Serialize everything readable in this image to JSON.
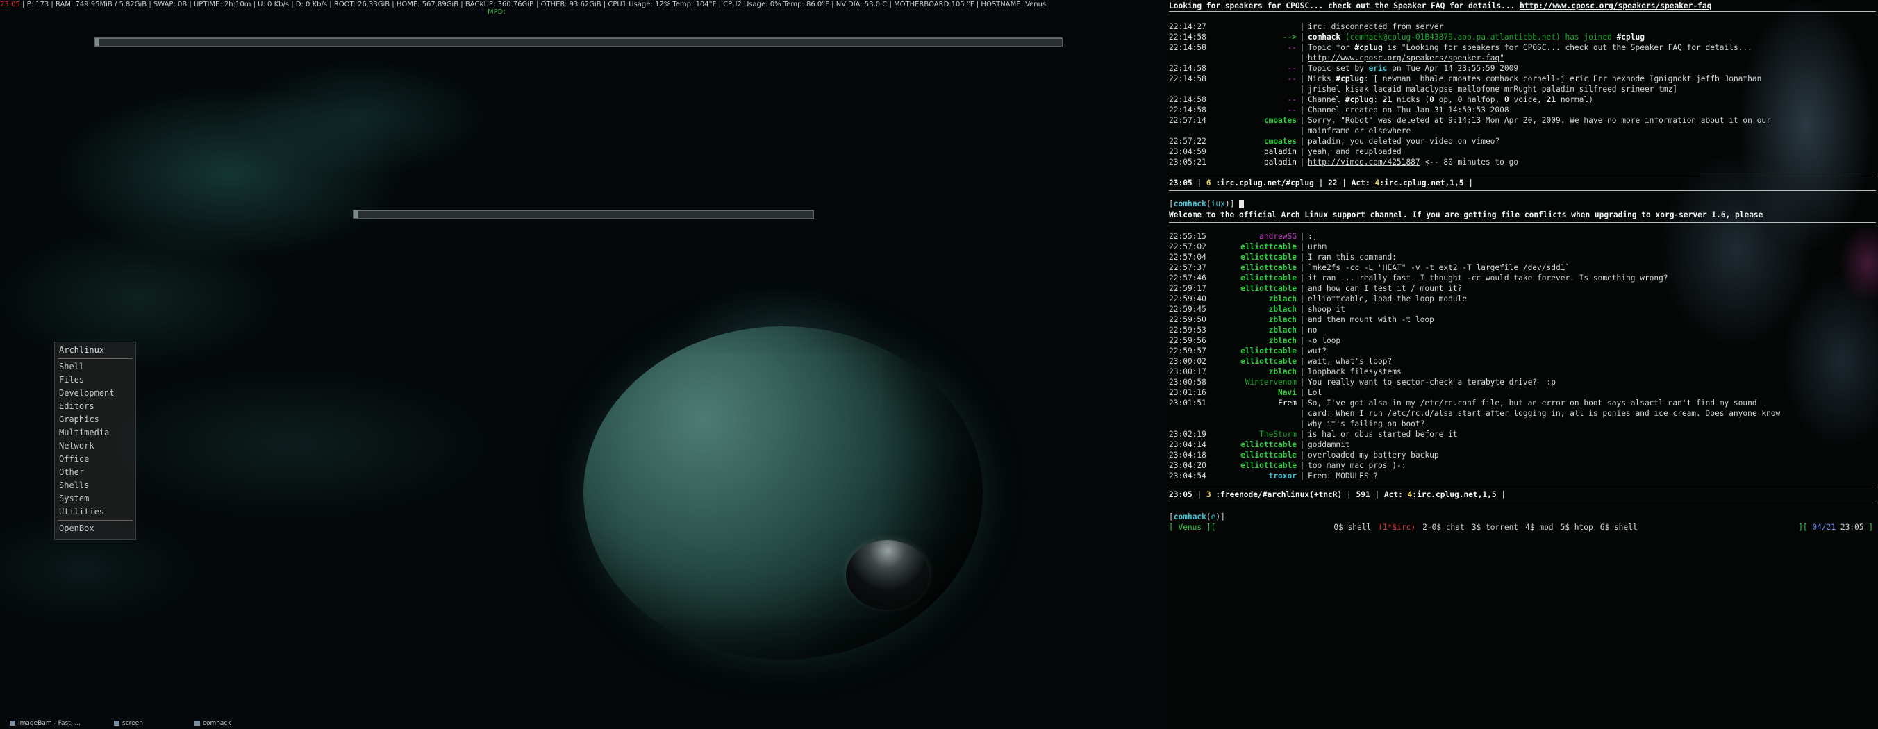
{
  "statusbar": {
    "time": "23:05",
    "items": [
      "P: 173",
      "RAM: 749.95MiB / 5.82GiB",
      "SWAP:  0B",
      "UPTIME: 2h:10m",
      "U: 0 Kb/s",
      "D: 0 Kb/s",
      "ROOT: 26.33GiB",
      "HOME: 567.89GiB",
      "BACKUP: 360.76GiB",
      "OTHER: 93.62GiB",
      "CPU1 Usage: 12% Temp:  104°F",
      "CPU2 Usage: 0% Temp:  86.0°F",
      "NVIDIA: 53.0 C",
      "MOTHERBOARD:105 °F",
      "HOSTNAME: Venus"
    ],
    "mpd": "MPD:"
  },
  "bars": {
    "bar1_fill": 0.004,
    "bar2_fill": 0.01
  },
  "menu": {
    "title": "Archlinux",
    "items": [
      "Shell",
      "Files",
      "Development",
      "Editors",
      "Graphics",
      "Multimedia",
      "Network",
      "Office",
      "Other",
      "Shells",
      "System",
      "Utilities"
    ],
    "footer": "OpenBox"
  },
  "taskbar": {
    "tasks": [
      {
        "label": "ImageBam - Fast, ..."
      },
      {
        "label": "screen"
      },
      {
        "label": "comhack"
      }
    ]
  },
  "irc1": {
    "topic_header": "Looking for speakers for CPOSC... check out the Speaker FAQ for details... ",
    "topic_header_url": "http://www.cposc.org/speakers/speaker-faq",
    "lines": [
      {
        "ts": "22:14:27",
        "nick": "",
        "parts": [
          {
            "t": "irc: disconnected from server",
            "c": ""
          }
        ]
      },
      {
        "ts": "22:14:58",
        "nick": "-->",
        "nc": "green",
        "parts": [
          {
            "t": "comhack",
            "c": "white bold"
          },
          {
            "t": " (comhack@cplug-01B43879.aoo.pa.atlanticbb.net) has joined ",
            "c": "dgreen"
          },
          {
            "t": "#cplug",
            "c": "white bold"
          }
        ]
      },
      {
        "ts": "22:14:58",
        "nick": "--",
        "nc": "magenta",
        "parts": [
          {
            "t": "Topic for ",
            "c": ""
          },
          {
            "t": "#cplug",
            "c": "white bold"
          },
          {
            "t": " is \"Looking for speakers for CPOSC... check out the Speaker FAQ for details...",
            "c": ""
          }
        ]
      },
      {
        "ts": "",
        "nick": "",
        "parts": [
          {
            "t": "http://www.cposc.org/speakers/speaker-faq\"",
            "c": "ul"
          }
        ]
      },
      {
        "ts": "22:14:58",
        "nick": "--",
        "nc": "magenta",
        "parts": [
          {
            "t": "Topic set by ",
            "c": ""
          },
          {
            "t": "eric",
            "c": "cyan bold"
          },
          {
            "t": " on Tue Apr 14 23:55:59 2009",
            "c": ""
          }
        ]
      },
      {
        "ts": "22:14:58",
        "nick": "--",
        "nc": "magenta",
        "parts": [
          {
            "t": "Nicks ",
            "c": ""
          },
          {
            "t": "#cplug",
            "c": "white bold"
          },
          {
            "t": ": [_newman_ bhale cmoates comhack cornell-j eric Err hexnode Ignignokt jeffb Jonathan",
            "c": ""
          }
        ]
      },
      {
        "ts": "",
        "nick": "",
        "parts": [
          {
            "t": "jrishel kisak lacaid malaclypse mellofone mrRught paladin silfreed srineer tmz]",
            "c": ""
          }
        ]
      },
      {
        "ts": "22:14:58",
        "nick": "--",
        "nc": "magenta",
        "parts": [
          {
            "t": "Channel ",
            "c": ""
          },
          {
            "t": "#cplug",
            "c": "white bold"
          },
          {
            "t": ": ",
            "c": ""
          },
          {
            "t": "21",
            "c": "white bold"
          },
          {
            "t": " nicks (",
            "c": ""
          },
          {
            "t": "0",
            "c": "white bold"
          },
          {
            "t": " op, ",
            "c": ""
          },
          {
            "t": "0",
            "c": "white bold"
          },
          {
            "t": " halfop, ",
            "c": ""
          },
          {
            "t": "0",
            "c": "white bold"
          },
          {
            "t": " voice, ",
            "c": ""
          },
          {
            "t": "21",
            "c": "white bold"
          },
          {
            "t": " normal)",
            "c": ""
          }
        ]
      },
      {
        "ts": "22:14:58",
        "nick": "--",
        "nc": "magenta",
        "parts": [
          {
            "t": "Channel created on Thu Jan 31 14:50:53 2008",
            "c": ""
          }
        ]
      },
      {
        "ts": "22:57:14",
        "nick": "cmoates",
        "nc": "green bold",
        "parts": [
          {
            "t": "Sorry, \"Robot\" was deleted at 9:14:13 Mon Apr 20, 2009. We have no more information about it on our",
            "c": ""
          }
        ]
      },
      {
        "ts": "",
        "nick": "",
        "parts": [
          {
            "t": "mainframe or elsewhere.",
            "c": ""
          }
        ]
      },
      {
        "ts": "22:57:22",
        "nick": "cmoates",
        "nc": "green bold",
        "parts": [
          {
            "t": "paladin, you deleted your video on vimeo?",
            "c": ""
          }
        ]
      },
      {
        "ts": "23:04:59",
        "nick": "paladin",
        "nc": "white",
        "parts": [
          {
            "t": "yeah, and reuploaded",
            "c": ""
          }
        ]
      },
      {
        "ts": "23:05:21",
        "nick": "paladin",
        "nc": "white",
        "parts": [
          {
            "t": "http://vimeo.com/4251887",
            "c": "ul"
          },
          {
            "t": " <-- 80 minutes to go",
            "c": ""
          }
        ]
      }
    ],
    "status": {
      "time": "23:05",
      "win": "6",
      "chan": ":irc.cplug.net/#cplug",
      "count": "22",
      "act": "Act: ",
      "actnum": "4",
      "actrest": ":irc.cplug.net,1,5"
    }
  },
  "irc2": {
    "input_nick": "comhack",
    "input_mode": "iux",
    "topic": "Welcome to the official Arch Linux support channel. If you are getting file conflicts when upgrading to xorg-server 1.6, please",
    "lines": [
      {
        "ts": "22:55:15",
        "nick": "andrewSG",
        "nc": "magenta",
        "parts": [
          {
            "t": ":]",
            "c": ""
          }
        ]
      },
      {
        "ts": "22:57:02",
        "nick": "elliottcable",
        "nc": "green bold",
        "parts": [
          {
            "t": "urhm",
            "c": ""
          }
        ]
      },
      {
        "ts": "22:57:04",
        "nick": "elliottcable",
        "nc": "green bold",
        "parts": [
          {
            "t": "I ran this command:",
            "c": ""
          }
        ]
      },
      {
        "ts": "22:57:37",
        "nick": "elliottcable",
        "nc": "green bold",
        "parts": [
          {
            "t": "`mke2fs -cc -L \"HEAT\" -v -t ext2 -T largefile /dev/sdd1`",
            "c": ""
          }
        ]
      },
      {
        "ts": "22:57:46",
        "nick": "elliottcable",
        "nc": "green bold",
        "parts": [
          {
            "t": "it ran ... really fast. I thought -cc would take forever. Is something wrong?",
            "c": ""
          }
        ]
      },
      {
        "ts": "22:59:17",
        "nick": "elliottcable",
        "nc": "green bold",
        "parts": [
          {
            "t": "and how can I test it / mount it?",
            "c": ""
          }
        ]
      },
      {
        "ts": "22:59:40",
        "nick": "zblach",
        "nc": "green bold",
        "parts": [
          {
            "t": "elliottcable, load the loop module",
            "c": ""
          }
        ]
      },
      {
        "ts": "22:59:45",
        "nick": "zblach",
        "nc": "green bold",
        "parts": [
          {
            "t": "shoop it",
            "c": ""
          }
        ]
      },
      {
        "ts": "22:59:50",
        "nick": "zblach",
        "nc": "green bold",
        "parts": [
          {
            "t": "and then mount with -t loop",
            "c": ""
          }
        ]
      },
      {
        "ts": "22:59:53",
        "nick": "zblach",
        "nc": "green bold",
        "parts": [
          {
            "t": "no",
            "c": ""
          }
        ]
      },
      {
        "ts": "22:59:56",
        "nick": "zblach",
        "nc": "green bold",
        "parts": [
          {
            "t": "-o loop",
            "c": ""
          }
        ]
      },
      {
        "ts": "22:59:57",
        "nick": "elliottcable",
        "nc": "green bold",
        "parts": [
          {
            "t": "wut?",
            "c": ""
          }
        ]
      },
      {
        "ts": "23:00:02",
        "nick": "elliottcable",
        "nc": "green bold",
        "parts": [
          {
            "t": "wait, what's loop?",
            "c": ""
          }
        ]
      },
      {
        "ts": "23:00:17",
        "nick": "zblach",
        "nc": "green bold",
        "parts": [
          {
            "t": "loopback filesystems",
            "c": ""
          }
        ]
      },
      {
        "ts": "23:00:58",
        "nick": "Wintervenom",
        "nc": "dgreen",
        "parts": [
          {
            "t": "You really want to sector-check a terabyte drive?  :p",
            "c": ""
          }
        ]
      },
      {
        "ts": "23:01:16",
        "nick": "Navi",
        "nc": "green bold",
        "parts": [
          {
            "t": "Lol",
            "c": ""
          }
        ]
      },
      {
        "ts": "23:01:51",
        "nick": "Frem",
        "nc": "white",
        "parts": [
          {
            "t": "So, I've got alsa in my /etc/rc.conf file, but an error on boot says alsactl can't find my sound",
            "c": ""
          }
        ]
      },
      {
        "ts": "",
        "nick": "",
        "parts": [
          {
            "t": "card. When I run /etc/rc.d/alsa start after logging in, all is ponies and ice cream. Does anyone know",
            "c": ""
          }
        ]
      },
      {
        "ts": "",
        "nick": "",
        "parts": [
          {
            "t": "why it's failing on boot?",
            "c": ""
          }
        ]
      },
      {
        "ts": "23:02:19",
        "nick": "TheStorm",
        "nc": "dgreen",
        "parts": [
          {
            "t": "is hal or dbus started before it",
            "c": ""
          }
        ]
      },
      {
        "ts": "23:04:14",
        "nick": "elliottcable",
        "nc": "green bold",
        "parts": [
          {
            "t": "goddamnit",
            "c": ""
          }
        ]
      },
      {
        "ts": "23:04:18",
        "nick": "elliottcable",
        "nc": "green bold",
        "parts": [
          {
            "t": "overloaded my battery backup",
            "c": ""
          }
        ]
      },
      {
        "ts": "23:04:20",
        "nick": "elliottcable",
        "nc": "green bold",
        "parts": [
          {
            "t": "too many mac pros )-:",
            "c": ""
          }
        ]
      },
      {
        "ts": "23:04:54",
        "nick": "troxor",
        "nc": "cyan bold",
        "parts": [
          {
            "t": "Frem: MODULES ?",
            "c": ""
          }
        ]
      }
    ],
    "status": {
      "time": "23:05",
      "win": "3",
      "chan": ":freenode/#archlinux",
      "mode": "(+tncR)",
      "count": "591",
      "act": "Act: ",
      "actnum": "4",
      "actrest": ":irc.cplug.net,1,5"
    }
  },
  "screen_bar": {
    "input_nick": "comhack",
    "input_mode": "e",
    "host": "[ Venus ][",
    "windows": [
      {
        "label": "0$ shell",
        "active": false
      },
      {
        "label": "(1*$irc)",
        "active": true
      },
      {
        "label": "2-0$ chat",
        "active": false
      },
      {
        "label": "3$ torrent",
        "active": false
      },
      {
        "label": "4$ mpd",
        "active": false
      },
      {
        "label": "5$ htop",
        "active": false
      },
      {
        "label": "6$ shell",
        "active": false
      }
    ],
    "right_bracket": "][",
    "date": "04/21",
    "time": "23:05",
    "right_end": "]"
  }
}
